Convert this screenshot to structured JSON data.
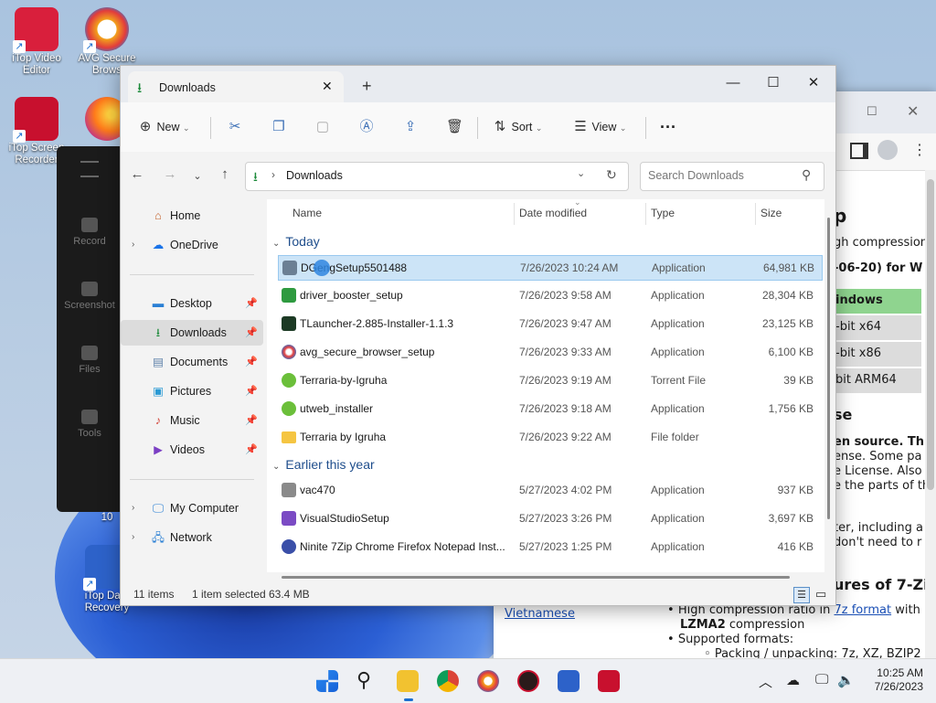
{
  "desktop": {
    "icons": [
      {
        "label": "iTop Video Editor"
      },
      {
        "label": "AVG Secure Brows"
      },
      {
        "label": "iTop Screen Recorder"
      },
      {
        "label": "Firefox"
      },
      {
        "label": "10"
      },
      {
        "label": "iTop Data Recovery"
      }
    ],
    "recorder_panel": [
      "Record",
      "Screenshot",
      "Files",
      "Tools"
    ]
  },
  "browser": {
    "lines": [
      "p",
      "gh compression",
      "-06-20) for W",
      "indows",
      "-bit x64",
      "-bit x86",
      "bit ARM64",
      "se",
      "en source. Th",
      "ense. Some pa",
      "e License. Also",
      "e the parts of the",
      "ter, including a",
      "don't need to r",
      "ures of 7-Zi"
    ],
    "link_vietnamese": "Vietnamese",
    "bullet1_pre": "High compression ratio in ",
    "bullet1_link": "7z format",
    "bullet1_post": " with",
    "bullet1_line2": "LZMA2",
    "bullet1_line2b": " compression",
    "bullet2": "Supported formats:",
    "sub_bullet": "Packing / unpacking: 7z, XZ, BZIP2"
  },
  "explorer": {
    "tab_title": "Downloads",
    "new_label": "New",
    "sort_label": "Sort",
    "view_label": "View",
    "address": "Downloads",
    "search_placeholder": "Search Downloads",
    "nav": {
      "home": "Home",
      "onedrive": "OneDrive",
      "desktop": "Desktop",
      "downloads": "Downloads",
      "documents": "Documents",
      "pictures": "Pictures",
      "music": "Music",
      "videos": "Videos",
      "mycomputer": "My Computer",
      "network": "Network"
    },
    "columns": {
      "name": "Name",
      "date": "Date modified",
      "type": "Type",
      "size": "Size"
    },
    "groups": {
      "today": "Today",
      "earlier": "Earlier this year"
    },
    "today_files": [
      {
        "name": "DGengSetup5501488",
        "date": "7/26/2023 10:24 AM",
        "type": "Application",
        "size": "64,981 KB"
      },
      {
        "name": "driver_booster_setup",
        "date": "7/26/2023 9:58 AM",
        "type": "Application",
        "size": "28,304 KB"
      },
      {
        "name": "TLauncher-2.885-Installer-1.1.3",
        "date": "7/26/2023 9:47 AM",
        "type": "Application",
        "size": "23,125 KB"
      },
      {
        "name": "avg_secure_browser_setup",
        "date": "7/26/2023 9:33 AM",
        "type": "Application",
        "size": "6,100 KB"
      },
      {
        "name": "Terraria-by-Igruha",
        "date": "7/26/2023 9:19 AM",
        "type": "Torrent File",
        "size": "39 KB"
      },
      {
        "name": "utweb_installer",
        "date": "7/26/2023 9:18 AM",
        "type": "Application",
        "size": "1,756 KB"
      },
      {
        "name": "Terraria by Igruha",
        "date": "7/26/2023 9:22 AM",
        "type": "File folder",
        "size": ""
      }
    ],
    "earlier_files": [
      {
        "name": "vac470",
        "date": "5/27/2023 4:02 PM",
        "type": "Application",
        "size": "937 KB"
      },
      {
        "name": "VisualStudioSetup",
        "date": "5/27/2023 3:26 PM",
        "type": "Application",
        "size": "3,697 KB"
      },
      {
        "name": "Ninite 7Zip Chrome Firefox Notepad Inst...",
        "date": "5/27/2023 1:25 PM",
        "type": "Application",
        "size": "416 KB"
      }
    ],
    "status": {
      "count": "11 items",
      "selected": "1 item selected",
      "size": "63.4 MB"
    }
  },
  "taskbar": {
    "time": "10:25 AM",
    "date": "7/26/2023"
  }
}
